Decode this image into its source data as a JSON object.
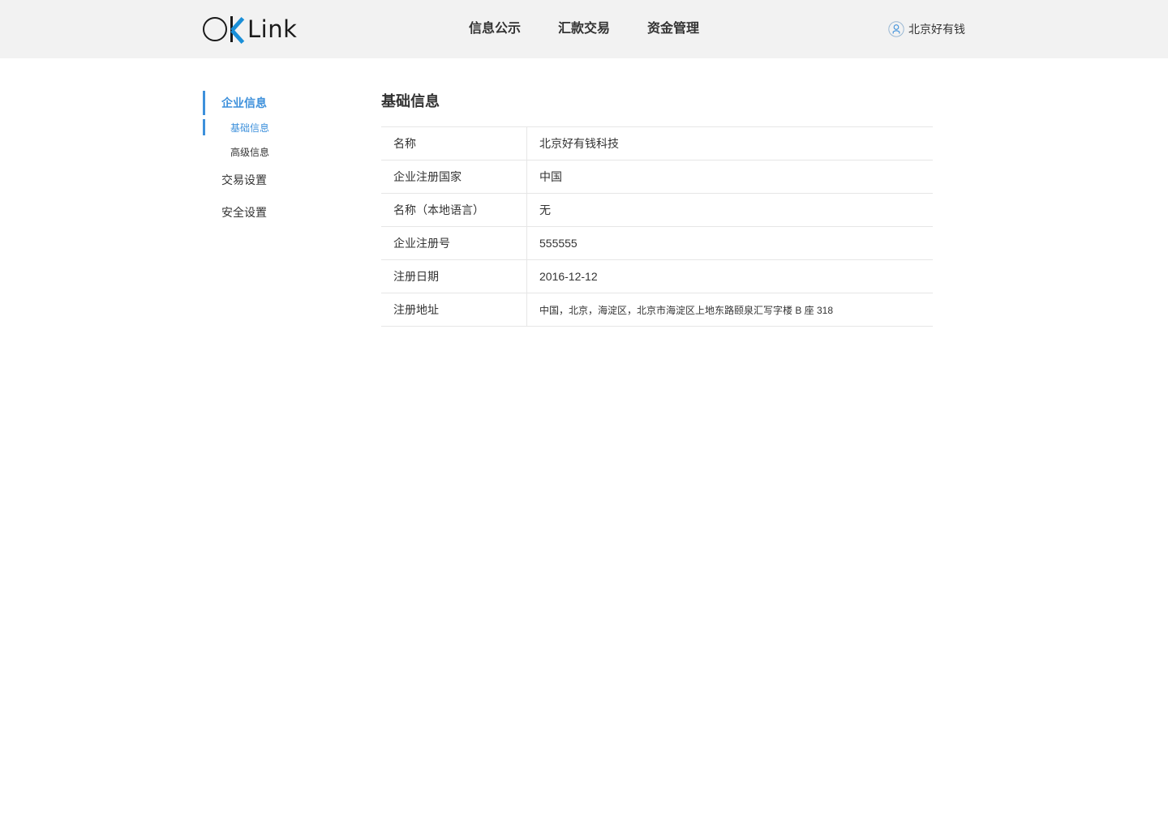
{
  "header": {
    "logo": {
      "prefix": "OK",
      "text": "Link",
      "icon": "oklink-logo"
    },
    "nav": [
      {
        "label": "信息公示"
      },
      {
        "label": "汇款交易"
      },
      {
        "label": "资金管理"
      }
    ],
    "user": {
      "name": "北京好有钱",
      "icon": "user-icon"
    }
  },
  "sidebar": {
    "groups": [
      {
        "label": "企业信息",
        "active": true,
        "items": [
          {
            "label": "基础信息",
            "active": true
          },
          {
            "label": "高级信息",
            "active": false
          }
        ]
      },
      {
        "label": "交易设置",
        "active": false
      },
      {
        "label": "安全设置",
        "active": false
      }
    ]
  },
  "main": {
    "title": "基础信息",
    "rows": [
      {
        "label": "名称",
        "value": "北京好有钱科技"
      },
      {
        "label": "企业注册国家",
        "value": "中国"
      },
      {
        "label": "名称（本地语言）",
        "value": "无"
      },
      {
        "label": "企业注册号",
        "value": "555555"
      },
      {
        "label": "注册日期",
        "value": "2016-12-12"
      },
      {
        "label": "注册地址",
        "value": "中国，北京，海淀区，北京市海淀区上地东路颐泉汇写字楼 B 座 318"
      }
    ]
  },
  "colors": {
    "accent": "#3d90db",
    "header_bg": "#f2f2f2",
    "logo_accent": "#1a8fd8",
    "border": "#e6e6e6",
    "text": "#333333"
  }
}
